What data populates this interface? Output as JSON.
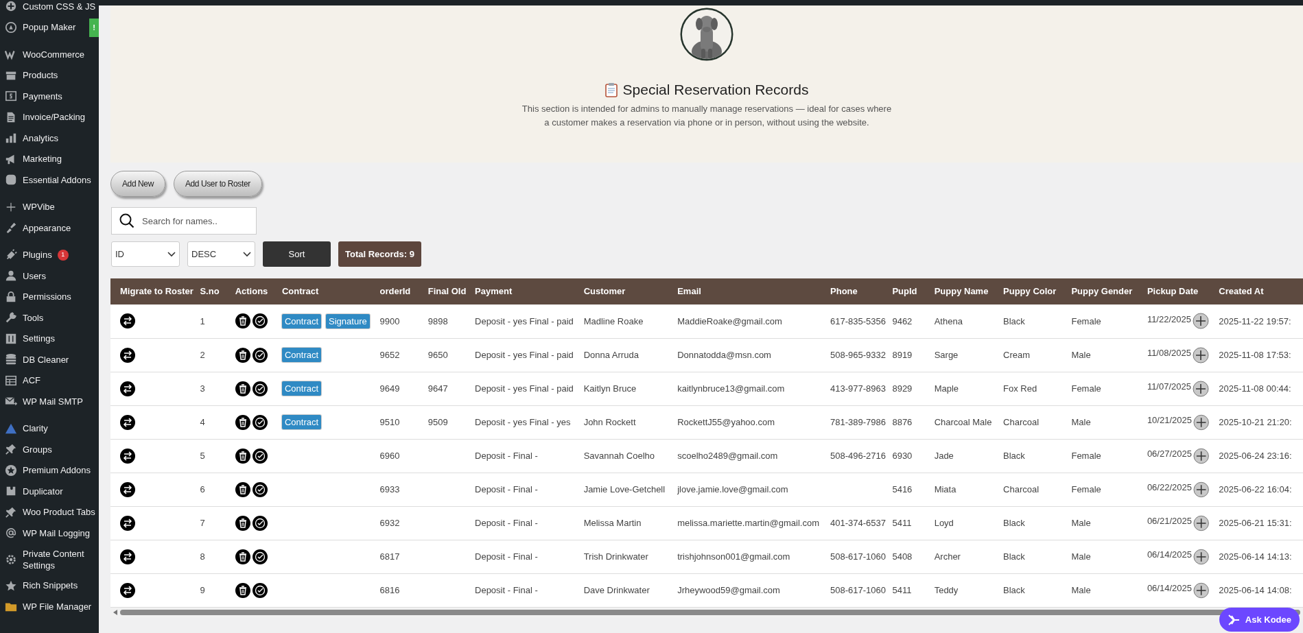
{
  "sidebar": {
    "groups": [
      [
        {
          "label": "Custom CSS & JS"
        },
        {
          "label": "Popup Maker",
          "badge": "!",
          "color": "#46b450"
        }
      ],
      [
        {
          "label": "WooCommerce"
        },
        {
          "label": "Products"
        },
        {
          "label": "Payments"
        },
        {
          "label": "Invoice/Packing"
        },
        {
          "label": "Analytics"
        },
        {
          "label": "Marketing"
        },
        {
          "label": "Essential Addons"
        }
      ],
      [
        {
          "label": "WPVibe"
        },
        {
          "label": "Appearance"
        }
      ],
      [
        {
          "label": "Plugins",
          "badge": "1",
          "color": "#d63638"
        },
        {
          "label": "Users"
        },
        {
          "label": "Permissions"
        },
        {
          "label": "Tools"
        },
        {
          "label": "Settings"
        },
        {
          "label": "DB Cleaner"
        },
        {
          "label": "ACF"
        },
        {
          "label": "WP Mail SMTP"
        }
      ],
      [
        {
          "label": "Clarity"
        },
        {
          "label": "Groups"
        },
        {
          "label": "Premium Addons"
        },
        {
          "label": "Duplicator"
        },
        {
          "label": "Woo Product Tabs"
        },
        {
          "label": "WP Mail Logging"
        },
        {
          "label": "Private Content Settings"
        },
        {
          "label": "Rich Snippets"
        },
        {
          "label": "WP File Manager"
        }
      ]
    ]
  },
  "header": {
    "title": "Special Reservation Records",
    "description": "This section is intended for admins to manually manage reservations — ideal for cases where a customer makes a reservation via phone or in person, without using the website."
  },
  "buttons": [
    "Add New",
    "Add User to Roster"
  ],
  "search": {
    "placeholder": "Search for names.."
  },
  "sort": {
    "field": "ID",
    "order": "DESC",
    "button": "Sort"
  },
  "total_records": "Total Records: 9",
  "table": {
    "columns": [
      "Migrate to Roster",
      "S.no",
      "Actions",
      "Contract",
      "orderId",
      "Final OId",
      "Payment",
      "Customer",
      "Email",
      "Phone",
      "PupId",
      "Puppy Name",
      "Puppy Color",
      "Puppy Gender",
      "Pickup Date",
      "Created At"
    ],
    "rows": [
      {
        "sno": "1",
        "contract": [
          "Contract",
          "Signature"
        ],
        "order_id": "9900",
        "final_oid": "9898",
        "payment": "Deposit - yes Final - paid",
        "customer": "Madline Roake",
        "email": "MaddieRoake@gmail.com",
        "phone": "617-835-5356",
        "pup_id": "9462",
        "puppy_name": "Athena",
        "puppy_color": "Black",
        "puppy_gender": "Female",
        "pickup_date": "11/22/2025",
        "created_at": "2025-11-22 19:57:"
      },
      {
        "sno": "2",
        "contract": [
          "Contract"
        ],
        "order_id": "9652",
        "final_oid": "9650",
        "payment": "Deposit - yes Final - paid",
        "customer": "Donna Arruda",
        "email": "Donnatodda@msn.com",
        "phone": "508-965-9332",
        "pup_id": "8919",
        "puppy_name": "Sarge",
        "puppy_color": "Cream",
        "puppy_gender": "Male",
        "pickup_date": "11/08/2025",
        "created_at": "2025-11-08 17:53:"
      },
      {
        "sno": "3",
        "contract": [
          "Contract"
        ],
        "order_id": "9649",
        "final_oid": "9647",
        "payment": "Deposit - yes Final - paid",
        "customer": "Kaitlyn Bruce",
        "email": "kaitlynbruce13@gmail.com",
        "phone": "413-977-8963",
        "pup_id": "8929",
        "puppy_name": "Maple",
        "puppy_color": "Fox Red",
        "puppy_gender": "Female",
        "pickup_date": "11/07/2025",
        "created_at": "2025-11-08 00:44:"
      },
      {
        "sno": "4",
        "contract": [
          "Contract"
        ],
        "order_id": "9510",
        "final_oid": "9509",
        "payment": "Deposit - yes Final - yes",
        "customer": "John Rockett",
        "email": "RockettJ55@yahoo.com",
        "phone": "781-389-7986",
        "pup_id": "8876",
        "puppy_name": "Charcoal Male",
        "puppy_color": "Charcoal",
        "puppy_gender": "Male",
        "pickup_date": "10/21/2025",
        "created_at": "2025-10-21 21:20:"
      },
      {
        "sno": "5",
        "order_id": "6960",
        "payment": "Deposit - Final -",
        "customer": "Savannah Coelho",
        "email": "scoelho2489@gmail.com",
        "phone": "508-496-2716",
        "pup_id": "6930",
        "puppy_name": "Jade",
        "puppy_color": "Black",
        "puppy_gender": "Female",
        "pickup_date": "06/27/2025",
        "created_at": "2025-06-24 23:16:"
      },
      {
        "sno": "6",
        "order_id": "6933",
        "payment": "Deposit - Final -",
        "customer": "Jamie Love-Getchell",
        "email": "jlove.jamie.love@gmail.com",
        "pup_id": "5416",
        "puppy_name": "Miata",
        "puppy_color": "Charcoal",
        "puppy_gender": "Female",
        "pickup_date": "06/22/2025",
        "created_at": "2025-06-22 16:04:"
      },
      {
        "sno": "7",
        "order_id": "6932",
        "payment": "Deposit - Final -",
        "customer": "Melissa Martin",
        "email": "melissa.mariette.martin@gmail.com",
        "phone": "401-374-6537",
        "pup_id": "5411",
        "puppy_name": "Loyd",
        "puppy_color": "Black",
        "puppy_gender": "Male",
        "pickup_date": "06/21/2025",
        "created_at": "2025-06-21 15:31:"
      },
      {
        "sno": "8",
        "order_id": "6817",
        "payment": "Deposit - Final -",
        "customer": "Trish Drinkwater",
        "email": "trishjohnson001@gmail.com",
        "phone": "508-617-1060",
        "pup_id": "5408",
        "puppy_name": "Archer",
        "puppy_color": "Black",
        "puppy_gender": "Male",
        "pickup_date": "06/14/2025",
        "created_at": "2025-06-14 14:13:"
      },
      {
        "sno": "9",
        "order_id": "6816",
        "payment": "Deposit - Final -",
        "customer": "Dave Drinkwater",
        "email": "Jrheywood59@gmail.com",
        "phone": "508-617-1060",
        "pup_id": "5411",
        "puppy_name": "Teddy",
        "puppy_color": "Black",
        "puppy_gender": "Male",
        "pickup_date": "06/14/2025",
        "created_at": "2025-06-14 14:08:"
      }
    ]
  },
  "chat_button": "Ask Kodee"
}
